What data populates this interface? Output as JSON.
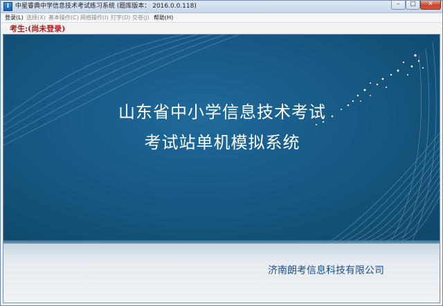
{
  "window": {
    "title": "中星睿典中学信息技术考试练习系统 (题库版本： 2016.0.0.118)",
    "icon": "app-icon",
    "controls": {
      "minimize": "–",
      "maximize": "□",
      "close": "✕"
    }
  },
  "menu": {
    "items": [
      {
        "label": "登录(L)",
        "enabled": true
      },
      {
        "label": "选择(X)",
        "enabled": false
      },
      {
        "label": "基本操作(C)",
        "enabled": false
      },
      {
        "label": "网络操作(I)",
        "enabled": false
      },
      {
        "label": "打字(D)",
        "enabled": false
      },
      {
        "label": "交卷(J)",
        "enabled": false
      },
      {
        "label": "帮助(H)",
        "enabled": true
      }
    ]
  },
  "status": {
    "user": "考生:(尚未登录)"
  },
  "splash": {
    "line1": "山东省中小学信息技术考试",
    "line2": "考试站单机模拟系统",
    "company": "济南朗考信息科技有限公司",
    "colors": {
      "primary": "#175984",
      "text": "#ffffff",
      "company": "#1b4f86",
      "user_status": "#b11a1a"
    }
  }
}
